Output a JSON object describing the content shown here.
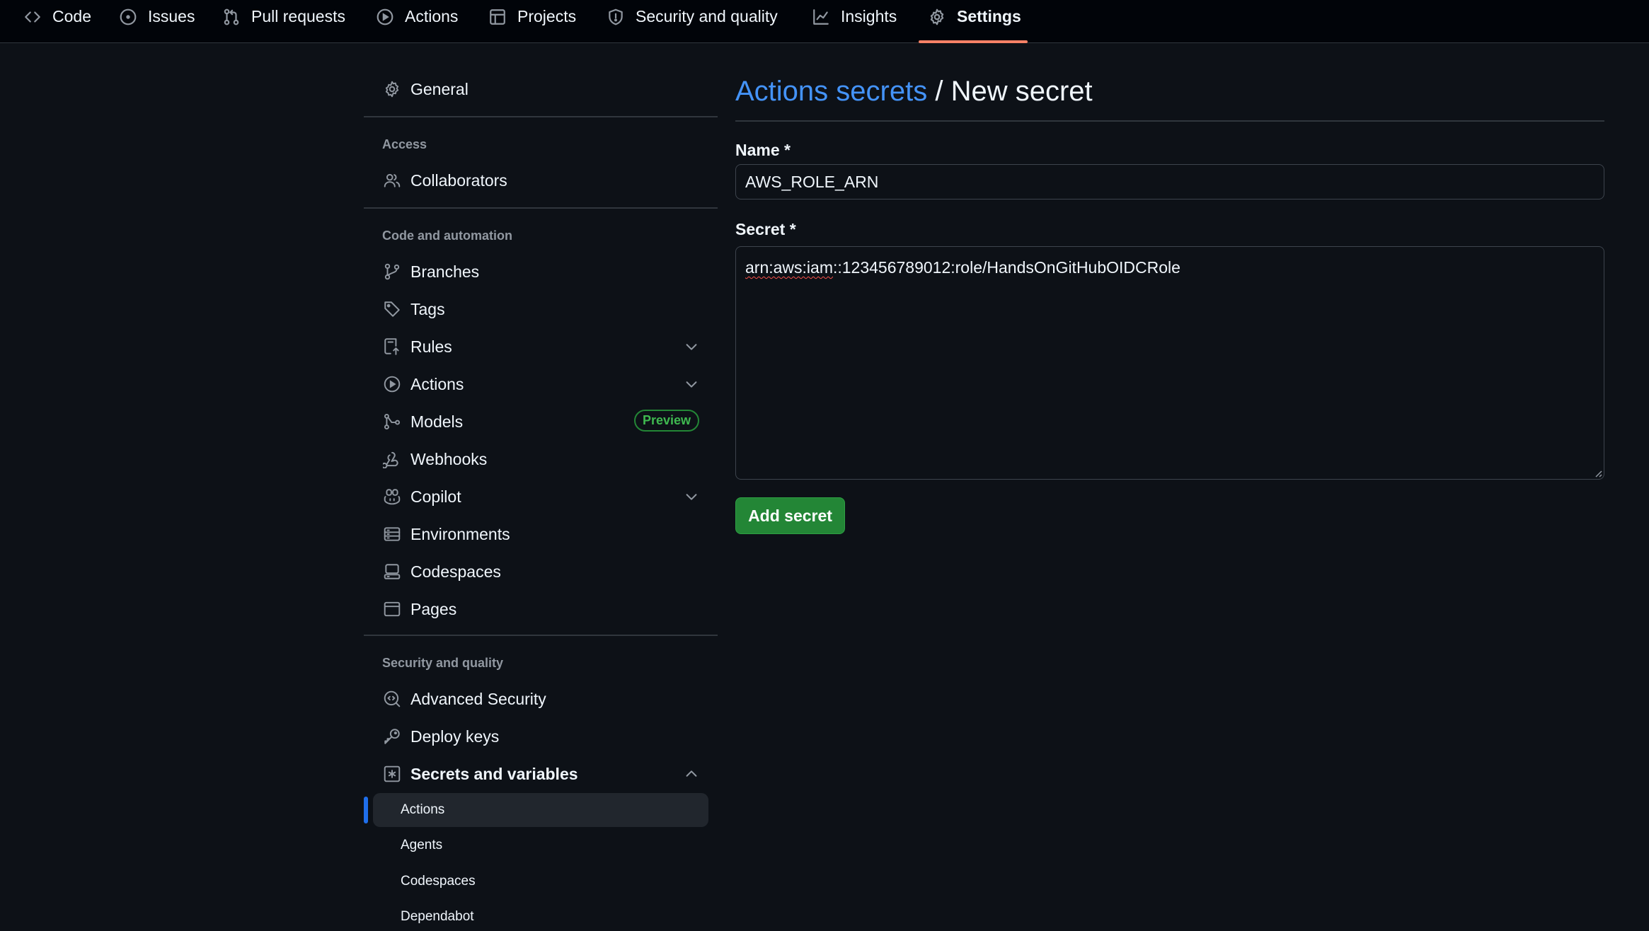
{
  "topnav": {
    "tabs": [
      {
        "label": "Code",
        "icon": "code-icon"
      },
      {
        "label": "Issues",
        "icon": "issue-icon"
      },
      {
        "label": "Pull requests",
        "icon": "pull-request-icon"
      },
      {
        "label": "Actions",
        "icon": "play-icon"
      },
      {
        "label": "Projects",
        "icon": "table-icon"
      },
      {
        "label": "Security and quality",
        "icon": "shield-icon"
      },
      {
        "label": "Insights",
        "icon": "graph-icon"
      },
      {
        "label": "Settings",
        "icon": "gear-icon",
        "active": true
      }
    ]
  },
  "sidebar": {
    "general": "General",
    "access_heading": "Access",
    "collaborators": "Collaborators",
    "code_heading": "Code and automation",
    "branches": "Branches",
    "tags": "Tags",
    "rules": "Rules",
    "actions": "Actions",
    "models": "Models",
    "models_badge": "Preview",
    "webhooks": "Webhooks",
    "copilot": "Copilot",
    "environments": "Environments",
    "codespaces": "Codespaces",
    "pages": "Pages",
    "security_heading": "Security and quality",
    "advanced_security": "Advanced Security",
    "deploy_keys": "Deploy keys",
    "secrets_and_variables": "Secrets and variables",
    "sub_items": [
      "Actions",
      "Agents",
      "Codespaces",
      "Dependabot"
    ]
  },
  "main": {
    "breadcrumb_link": "Actions secrets",
    "breadcrumb_sep": " / ",
    "page_title": "New secret",
    "name_label": "Name *",
    "name_value": "AWS_ROLE_ARN",
    "secret_label": "Secret *",
    "secret_value_underlined": "arn:aws:iam",
    "secret_value_rest": "::123456789012:role/HandsOnGitHubOIDCRole",
    "submit_label": "Add secret"
  },
  "colors": {
    "accent_link": "#4493f8",
    "primary_button": "#238636",
    "active_tab_underline": "#f78166",
    "active_nav_bar": "#1f6feb"
  }
}
